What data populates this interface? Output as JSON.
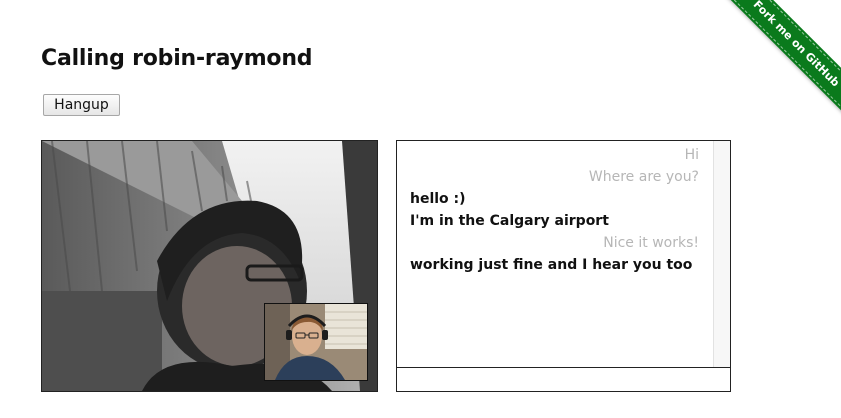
{
  "header": {
    "title": "Calling robin-raymond"
  },
  "controls": {
    "hangup_label": "Hangup"
  },
  "ribbon": {
    "label": "Fork me on GitHub",
    "color": "#0a7a1c"
  },
  "chat": {
    "messages": [
      {
        "from": "remote",
        "text": "Hi"
      },
      {
        "from": "remote",
        "text": "Where are you?"
      },
      {
        "from": "local",
        "text": "hello :)"
      },
      {
        "from": "local",
        "text": "I'm in the Calgary airport"
      },
      {
        "from": "remote",
        "text": "Nice it works!"
      },
      {
        "from": "local",
        "text": "working just fine and I hear you too"
      }
    ],
    "input_value": "",
    "colors": {
      "remote_text": "#b6b6b6",
      "local_text": "#111111"
    }
  }
}
